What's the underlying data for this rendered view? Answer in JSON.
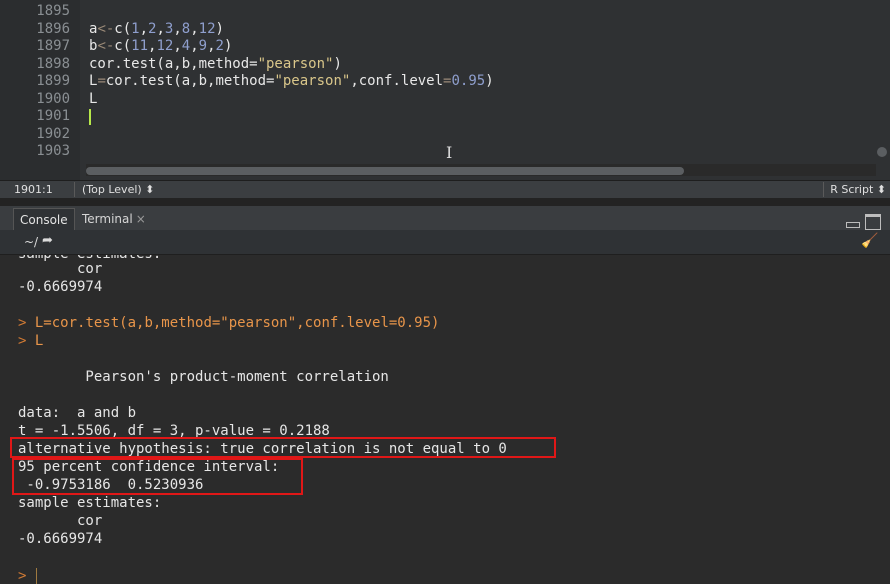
{
  "editor": {
    "line_numbers": [
      "1895",
      "1896",
      "1897",
      "1898",
      "1899",
      "1900",
      "1901",
      "1902",
      "1903"
    ],
    "lines": {
      "l1896": {
        "a": "a",
        "op": "<-",
        "fn": "c(",
        "n1": "1",
        ",": ",",
        "n2": "2",
        "n3": "3",
        "n4": "8",
        "n5": "12",
        "close": ")"
      },
      "l1897": {
        "a": "b",
        "op": "<-",
        "fn": "c(",
        "n1": "11",
        "n2": "12",
        "n3": "4",
        "n4": "9",
        "n5": "2",
        "close": ")"
      },
      "l1898": {
        "pre": "cor.test(a,b,method=",
        "str": "\"pearson\"",
        "close": ")"
      },
      "l1899": {
        "pre": "L",
        "op": "=",
        "mid": "cor.test(a,b,method=",
        "str": "\"pearson\"",
        "post": ",conf.level",
        "op2": "=",
        "num": "0.95",
        "close": ")"
      },
      "l1900": {
        "text": "L"
      }
    }
  },
  "status": {
    "position": "1901:1",
    "scope": "(Top Level) ⬍",
    "file_type": "R Script ⬍"
  },
  "console_tabs": {
    "console": "Console",
    "terminal": "Terminal",
    "terminal_close": "×"
  },
  "toolbar": {
    "path": "~/",
    "goto_icon": "➦",
    "broom_icon": "🧹"
  },
  "console": {
    "partial_top": "sample estimates:",
    "cor_label_1": "       cor",
    "cor_value_1": "-0.6669974",
    "cmd_prompt_1": ">",
    "cmd_1": " L=cor.test(a,b,method=\"pearson\",conf.level=0.95)",
    "cmd_prompt_2": ">",
    "cmd_2": " L",
    "title": "        Pearson's product-moment correlation",
    "data_line": "data:  a and b",
    "stat_line": "t = -1.5506, df = 3, p-value = 0.2188",
    "alt_line": "alternative hypothesis: true correlation is not equal to 0",
    "ci_title": "95 percent confidence interval:",
    "ci_values": " -0.9753186  0.5230936",
    "sample_est": "sample estimates:",
    "cor_label_2": "       cor",
    "cor_value_2": "-0.6669974",
    "final_prompt": ">"
  },
  "colors": {
    "highlight_box": "#e01717",
    "command_text": "#e8954a",
    "cursor_line": "#b7e84a"
  }
}
